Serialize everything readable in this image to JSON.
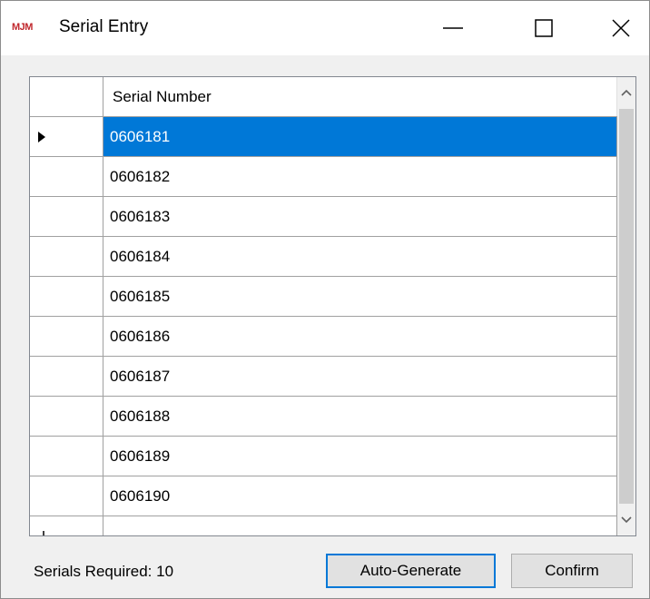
{
  "window": {
    "logo_text": "MJM",
    "title": "Serial Entry",
    "icons": {
      "minimize": "minimize-icon",
      "maximize": "maximize-icon",
      "close": "close-icon"
    }
  },
  "grid": {
    "columns": [
      "Serial Number"
    ],
    "selected_row_index": 0,
    "rows": [
      {
        "serial": "0606181"
      },
      {
        "serial": "0606182"
      },
      {
        "serial": "0606183"
      },
      {
        "serial": "0606184"
      },
      {
        "serial": "0606185"
      },
      {
        "serial": "0606186"
      },
      {
        "serial": "0606187"
      },
      {
        "serial": "0606188"
      },
      {
        "serial": "0606189"
      },
      {
        "serial": "0606190"
      },
      {
        "serial": ""
      }
    ],
    "colors": {
      "selection": "#0078d7"
    }
  },
  "footer": {
    "serials_required": "Serials Required: 10",
    "auto_generate_label": "Auto-Generate",
    "confirm_label": "Confirm"
  }
}
